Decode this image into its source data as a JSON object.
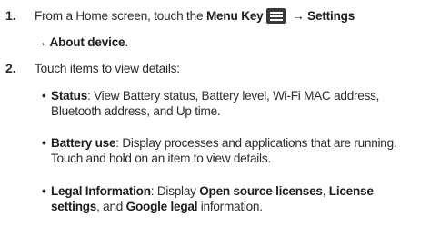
{
  "steps": [
    {
      "number": "1.",
      "prefix": "From a Home screen, touch the ",
      "menu_key": "Menu Key",
      "arrow1": " → ",
      "settings": "Settings",
      "arrow2": "→ ",
      "about": "About device",
      "end": ".",
      "icon": "menu-key-icon"
    },
    {
      "number": "2.",
      "text": "Touch items to view details:"
    }
  ],
  "items": [
    {
      "bullet": "•",
      "term": "Status",
      "desc": ": View Battery status, Battery level, Wi-Fi MAC address, Bluetooth address, and Up time."
    },
    {
      "bullet": "•",
      "term": "Battery use",
      "desc": ": Display processes and applications that are running. Touch and hold on an item to view details."
    },
    {
      "bullet": "•",
      "term": "Legal Information",
      "desc_a": ": Display ",
      "link_a": "Open source licenses",
      "sep": ", ",
      "link_b": "License settings",
      "desc_b": ", and ",
      "link_c": "Google legal",
      "desc_c": " information."
    }
  ]
}
